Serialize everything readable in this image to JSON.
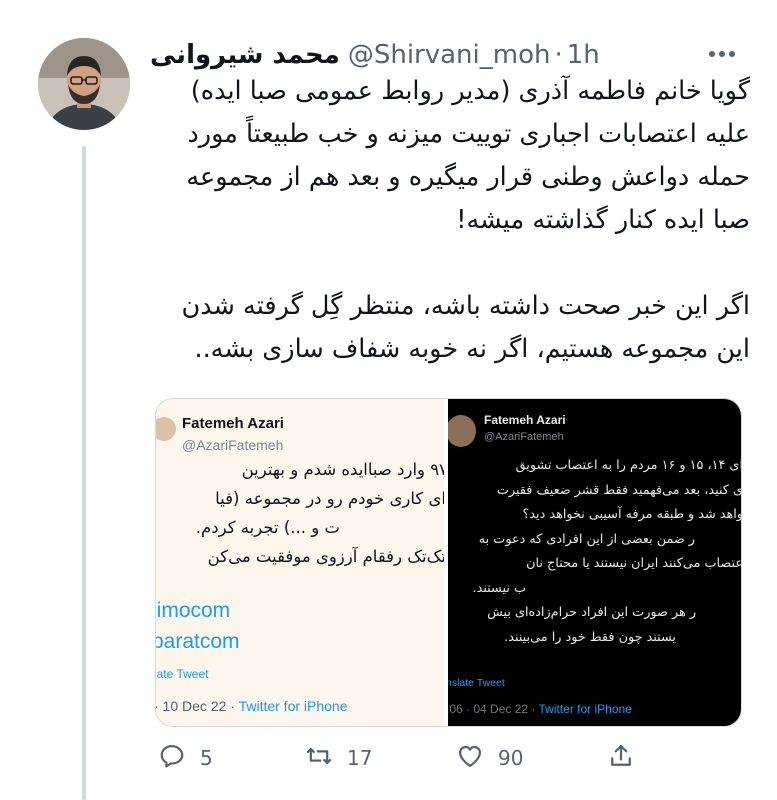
{
  "tweet": {
    "display_name": "محمد شیروانی",
    "handle": "@Shirvani_moh",
    "separator": "·",
    "time": "1h",
    "text": "گویا خانم فاطمه آذری (مدیر روابط عمومی صبا ایده) علیه اعتصابات اجباری توییت میزنه و خب طبیعتاً مورد حمله دواعش وطنی قرار میگیره و بعد هم از مجموعه صبا ایده کنار گذاشته میشه!\n\nاگر این خبر صحت داشته باشه، منتظر گِل گرفته شدن این مجموعه هستیم، اگر نه خوبه شفاف سازی بشه..",
    "icons": {
      "more": "more-icon",
      "reply": "reply-icon",
      "retweet": "retweet-icon",
      "like": "like-icon",
      "share": "share-icon"
    }
  },
  "media": {
    "left_shot": {
      "name": "Fatemeh Azari",
      "handle": "@AzariFatemeh",
      "lines": [
        "۹۷ وارد صباایده شدم و بهترین",
        "ای کاری خودم رو در مجموعه (فیا",
        "ت و ...) تجربه کردم.",
        "تک‌تک رفقام آرزوی موفقیت می‌کن"
      ],
      "links": [
        "limocom",
        "paratcom"
      ],
      "translate": "late Tweet",
      "meta_date": "· 10 Dec 22 · ",
      "meta_source": "Twitter for iPhone"
    },
    "right_shot": {
      "name": "Fatemeh Azari",
      "handle": "@AzariFatemeh",
      "lines": [
        "ای ۱۴، ۱۵ و ۱۶ مردم را به اعتصاب تشویق",
        "ی کنید، بعد می‌فهمید فقط قشر ضعیف فقیرت",
        "واهد شد و طبقه مرفه آسیبی نخواهد دید؟",
        "ر ضمن بعضی از این افرادی که دعوت به",
        "عتصاب می‌کنند ایران نیستند یا محتاج نان",
        "ب نیستند.",
        "ر هر صورت این افراد حرام‌زاده‌ای بیش",
        "یستند چون فقط خود را می‌بینند."
      ],
      "translate": "nslate Tweet",
      "meta_date": ":06 · 04 Dec 22 · ",
      "meta_source": "Twitter for iPhone"
    }
  },
  "actions": {
    "replies": "5",
    "retweets": "17",
    "likes": "90"
  },
  "colors": {
    "text": "#0f1419",
    "secondary": "#536471",
    "link": "#1d9bf0",
    "border": "#cfd9de"
  }
}
